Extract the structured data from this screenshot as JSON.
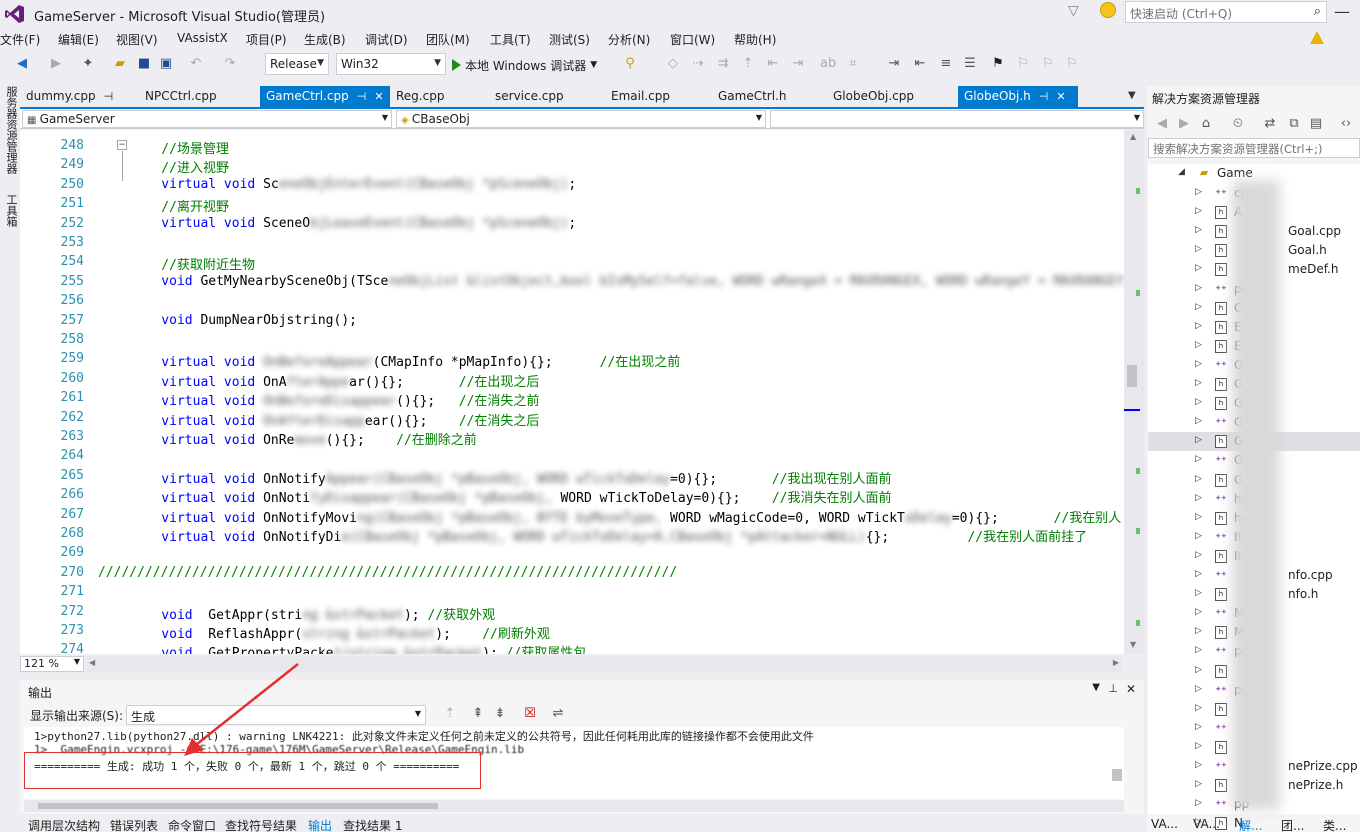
{
  "window": {
    "title": "GameServer - Microsoft Visual Studio(管理员)",
    "quick_launch_placeholder": "快速启动 (Ctrl+Q)"
  },
  "menu": [
    "文件(F)",
    "编辑(E)",
    "视图(V)",
    "VAssistX",
    "项目(P)",
    "生成(B)",
    "调试(D)",
    "团队(M)",
    "工具(T)",
    "测试(S)",
    "分析(N)",
    "窗口(W)",
    "帮助(H)"
  ],
  "toolbar": {
    "config": "Release",
    "platform": "Win32",
    "run_label": "本地 Windows 调试器"
  },
  "left_strip": [
    "服务器资源管理器",
    "工具箱"
  ],
  "doc_tabs": [
    {
      "label": "dummy.cpp",
      "active": false,
      "pinned": true
    },
    {
      "label": "NPCCtrl.cpp",
      "active": false,
      "pinned": false
    },
    {
      "label": "GameCtrl.cpp",
      "active": true,
      "pinned": true
    },
    {
      "label": "Reg.cpp",
      "active": false,
      "pinned": false
    },
    {
      "label": "service.cpp",
      "active": false,
      "pinned": false
    },
    {
      "label": "Email.cpp",
      "active": false,
      "pinned": false
    },
    {
      "label": "GameCtrl.h",
      "active": false,
      "pinned": false
    },
    {
      "label": "GlobeObj.cpp",
      "active": false,
      "pinned": false
    },
    {
      "label": "GlobeObj.h",
      "active": true,
      "pinned": true
    }
  ],
  "nav": {
    "project": "GameServer",
    "scope": "CBaseObj"
  },
  "editor": {
    "zoom": "121 %",
    "lines": [
      {
        "n": "248",
        "parts": [
          {
            "t": "    //场景管理",
            "c": "cm"
          }
        ]
      },
      {
        "n": "249",
        "parts": [
          {
            "t": "    //进入视野",
            "c": "cm"
          }
        ]
      },
      {
        "n": "250",
        "parts": [
          {
            "t": "    virtual void ",
            "c": "kw"
          },
          {
            "t": "Sc",
            "c": ""
          },
          {
            "t": "eneObjEnterEvent(CBaseObj *pSceneObj)",
            "c": "blur"
          },
          {
            "t": ";",
            "c": ""
          }
        ]
      },
      {
        "n": "251",
        "parts": [
          {
            "t": "    //离开视野",
            "c": "cm"
          }
        ]
      },
      {
        "n": "252",
        "parts": [
          {
            "t": "    virtual void ",
            "c": "kw"
          },
          {
            "t": "SceneO",
            "c": ""
          },
          {
            "t": "bjLeaveEvent(CBaseObj *pSceneObj)",
            "c": "blur"
          },
          {
            "t": ";",
            "c": ""
          }
        ]
      },
      {
        "n": "253",
        "parts": []
      },
      {
        "n": "254",
        "parts": [
          {
            "t": "    //获取附近生物",
            "c": "cm"
          }
        ]
      },
      {
        "n": "255",
        "parts": [
          {
            "t": "    void ",
            "c": "kw"
          },
          {
            "t": "GetMyNearbySceneObj(TSce",
            "c": ""
          },
          {
            "t": "neObjList &listObject,bool bIsMySelf=false, WORD wRangeX = MAXRANGEX, WORD wRangeY = MAXRANGEY,",
            "c": "blur"
          }
        ]
      },
      {
        "n": "256",
        "parts": []
      },
      {
        "n": "257",
        "parts": [
          {
            "t": "    void ",
            "c": "kw"
          },
          {
            "t": "DumpNearObjstring();",
            "c": ""
          }
        ]
      },
      {
        "n": "258",
        "parts": []
      },
      {
        "n": "259",
        "parts": [
          {
            "t": "    virtual void ",
            "c": "kw"
          },
          {
            "t": "OnBeforeAppear",
            "c": "blur"
          },
          {
            "t": "(CMapInfo *pMapInfo){};      ",
            "c": ""
          },
          {
            "t": "//在出现之前",
            "c": "cm"
          }
        ]
      },
      {
        "n": "260",
        "parts": [
          {
            "t": "    virtual void ",
            "c": "kw"
          },
          {
            "t": "OnA",
            "c": ""
          },
          {
            "t": "fterAppe",
            "c": "blur"
          },
          {
            "t": "ar(){};       ",
            "c": ""
          },
          {
            "t": "//在出现之后",
            "c": "cm"
          }
        ]
      },
      {
        "n": "261",
        "parts": [
          {
            "t": "    virtual void ",
            "c": "kw"
          },
          {
            "t": "OnBeforeDisappear",
            "c": "blur"
          },
          {
            "t": "(){};   ",
            "c": ""
          },
          {
            "t": "//在消失之前",
            "c": "cm"
          }
        ]
      },
      {
        "n": "262",
        "parts": [
          {
            "t": "    virtual void ",
            "c": "kw"
          },
          {
            "t": "OnAfterDisapp",
            "c": "blur"
          },
          {
            "t": "ear(){};    ",
            "c": ""
          },
          {
            "t": "//在消失之后",
            "c": "cm"
          }
        ]
      },
      {
        "n": "263",
        "parts": [
          {
            "t": "    virtual void ",
            "c": "kw"
          },
          {
            "t": "OnRe",
            "c": ""
          },
          {
            "t": "move",
            "c": "blur"
          },
          {
            "t": "(){};    ",
            "c": ""
          },
          {
            "t": "//在删除之前",
            "c": "cm"
          }
        ]
      },
      {
        "n": "264",
        "parts": []
      },
      {
        "n": "265",
        "parts": [
          {
            "t": "    virtual void ",
            "c": "kw"
          },
          {
            "t": "OnNotify",
            "c": ""
          },
          {
            "t": "Appear(CBaseObj *pBaseObj, WORD wTickToDelay",
            "c": "blur"
          },
          {
            "t": "=0){};       ",
            "c": ""
          },
          {
            "t": "//我出现在别人面前",
            "c": "cm"
          }
        ]
      },
      {
        "n": "266",
        "parts": [
          {
            "t": "    virtual void ",
            "c": "kw"
          },
          {
            "t": "OnNoti",
            "c": ""
          },
          {
            "t": "fyDisappear(CBaseObj *pBaseObj, ",
            "c": "blur"
          },
          {
            "t": "WORD wTickToDelay=0){};    ",
            "c": ""
          },
          {
            "t": "//我消失在别人面前",
            "c": "cm"
          }
        ]
      },
      {
        "n": "267",
        "parts": [
          {
            "t": "    virtual void ",
            "c": "kw"
          },
          {
            "t": "OnNotifyMovi",
            "c": ""
          },
          {
            "t": "ng(CBaseObj *pBaseObj, BYTE byMoveType,",
            "c": "blur"
          },
          {
            "t": " WORD wMagicCode=0, WORD wTickT",
            "c": ""
          },
          {
            "t": "oDelay",
            "c": "blur"
          },
          {
            "t": "=0){};       ",
            "c": ""
          },
          {
            "t": "//我在别人",
            "c": "cm"
          }
        ]
      },
      {
        "n": "268",
        "parts": [
          {
            "t": "    virtual void ",
            "c": "kw"
          },
          {
            "t": "OnNotifyDi",
            "c": ""
          },
          {
            "t": "e(CBaseObj *pBaseObj, WORD wTickToDelay=0,CBaseObj *pAttacker=NULL)",
            "c": "blur"
          },
          {
            "t": "{};          ",
            "c": ""
          },
          {
            "t": "//我在别人面前挂了",
            "c": "cm"
          }
        ]
      },
      {
        "n": "269",
        "parts": []
      },
      {
        "n": "270",
        "parts": [
          {
            "t": "//////////////////////////////////////////////////////////////////////////",
            "c": "cm"
          }
        ]
      },
      {
        "n": "271",
        "parts": []
      },
      {
        "n": "272",
        "parts": [
          {
            "t": "    void  ",
            "c": "kw"
          },
          {
            "t": "GetAppr(stri",
            "c": ""
          },
          {
            "t": "ng &strPacket",
            "c": "blur"
          },
          {
            "t": "); ",
            "c": ""
          },
          {
            "t": "//获取外观",
            "c": "cm"
          }
        ]
      },
      {
        "n": "273",
        "parts": [
          {
            "t": "    void  ",
            "c": "kw"
          },
          {
            "t": "ReflashAppr(",
            "c": ""
          },
          {
            "t": "string &strPacket",
            "c": "blur"
          },
          {
            "t": ");    ",
            "c": ""
          },
          {
            "t": "//刷新外观",
            "c": "cm"
          }
        ]
      },
      {
        "n": "274",
        "parts": [
          {
            "t": "    void  ",
            "c": "kw"
          },
          {
            "t": "GetPropertyPacke",
            "c": ""
          },
          {
            "t": "t(string &strPacket",
            "c": "blur"
          },
          {
            "t": "); ",
            "c": ""
          },
          {
            "t": "//获取属性包",
            "c": "cm"
          }
        ]
      }
    ]
  },
  "output": {
    "title": "输出",
    "source_label": "显示输出来源(S):",
    "source_value": "生成",
    "lines": [
      "1>python27.lib(python27.dll) : warning LNK4221: 此对象文件未定义任何之前未定义的公共符号，因此任何耗用此库的链接操作都不会使用此文件",
      "1>  GameEngin.vcxproj -> E:\\176-game\\176M\\GameServer\\Release\\GameEngin.lib",
      "========== 生成: 成功 1 个，失败 0 个，最新 1 个，跳过 0 个 =========="
    ]
  },
  "bottom_tabs": [
    {
      "label": "调用层次结构",
      "active": false
    },
    {
      "label": "错误列表",
      "active": false
    },
    {
      "label": "命令窗口",
      "active": false
    },
    {
      "label": "查找符号结果",
      "active": false
    },
    {
      "label": "输出",
      "active": true
    },
    {
      "label": "查找结果 1",
      "active": false
    }
  ],
  "solution_explorer": {
    "title": "解决方案资源管理器",
    "search_placeholder": "搜索解决方案资源管理器(Ctrl+;)",
    "root": "Game",
    "items": [
      {
        "label": "cpp",
        "type": "cpp"
      },
      {
        "label": "A",
        "type": "h"
      },
      {
        "label": "Goal.cpp",
        "type": "h"
      },
      {
        "label": "Goal.h",
        "type": "h"
      },
      {
        "label": "meDef.h",
        "type": "h"
      },
      {
        "label": "pp",
        "type": "cpp"
      },
      {
        "label": "C",
        "type": "h"
      },
      {
        "label": "E",
        "type": "h"
      },
      {
        "label": "Em",
        "type": "h"
      },
      {
        "label": "G",
        "type": "cpp"
      },
      {
        "label": "G",
        "type": "h"
      },
      {
        "label": "G",
        "type": "h"
      },
      {
        "label": "G",
        "type": "cpp"
      },
      {
        "label": "G",
        "type": "h",
        "selected": true
      },
      {
        "label": "G",
        "type": "cpp"
      },
      {
        "label": "G",
        "type": "h"
      },
      {
        "label": "ha",
        "type": "cpp"
      },
      {
        "label": "ha",
        "type": "h"
      },
      {
        "label": "It",
        "type": "cpp"
      },
      {
        "label": "It",
        "type": "h"
      },
      {
        "label": "nfo.cpp",
        "type": "cpp"
      },
      {
        "label": "nfo.h",
        "type": "h"
      },
      {
        "label": "M",
        "type": "cpp"
      },
      {
        "label": "M",
        "type": "h"
      },
      {
        "label": "pp",
        "type": "cpp"
      },
      {
        "label": "",
        "type": "h"
      },
      {
        "label": "pp",
        "type": "cpp"
      },
      {
        "label": "",
        "type": "h"
      },
      {
        "label": "",
        "type": "cpp"
      },
      {
        "label": "",
        "type": "h"
      },
      {
        "label": "nePrize.cpp",
        "type": "cpp"
      },
      {
        "label": "nePrize.h",
        "type": "h"
      },
      {
        "label": "pp",
        "type": "cpp"
      },
      {
        "label": "N",
        "type": "h"
      }
    ],
    "bottom_tabs": [
      "VA...",
      "VA...",
      "解...",
      "团...",
      "类..."
    ]
  },
  "colors": {
    "accent": "#007acc",
    "keyword": "#0000ff",
    "comment": "#008000",
    "line_number": "#2b91af",
    "highlight_box": "#e03030"
  }
}
